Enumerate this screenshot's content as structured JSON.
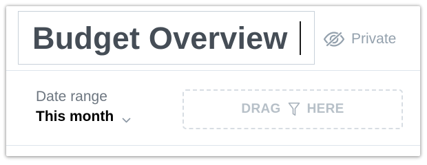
{
  "dashboard": {
    "title": "Budget Overview"
  },
  "visibility": {
    "label": "Private",
    "icon": "eye-slash-icon"
  },
  "date_filter": {
    "label": "Date range",
    "value": "This month",
    "icon": "chevron-down-icon"
  },
  "drop_zone": {
    "text_before": "DRAG",
    "text_after": "HERE",
    "icon": "funnel-icon"
  },
  "colors": {
    "title_text": "#454d56",
    "muted_text": "#94a1ad",
    "placeholder_text": "#b7c0c8",
    "border": "#c8d0d9"
  }
}
